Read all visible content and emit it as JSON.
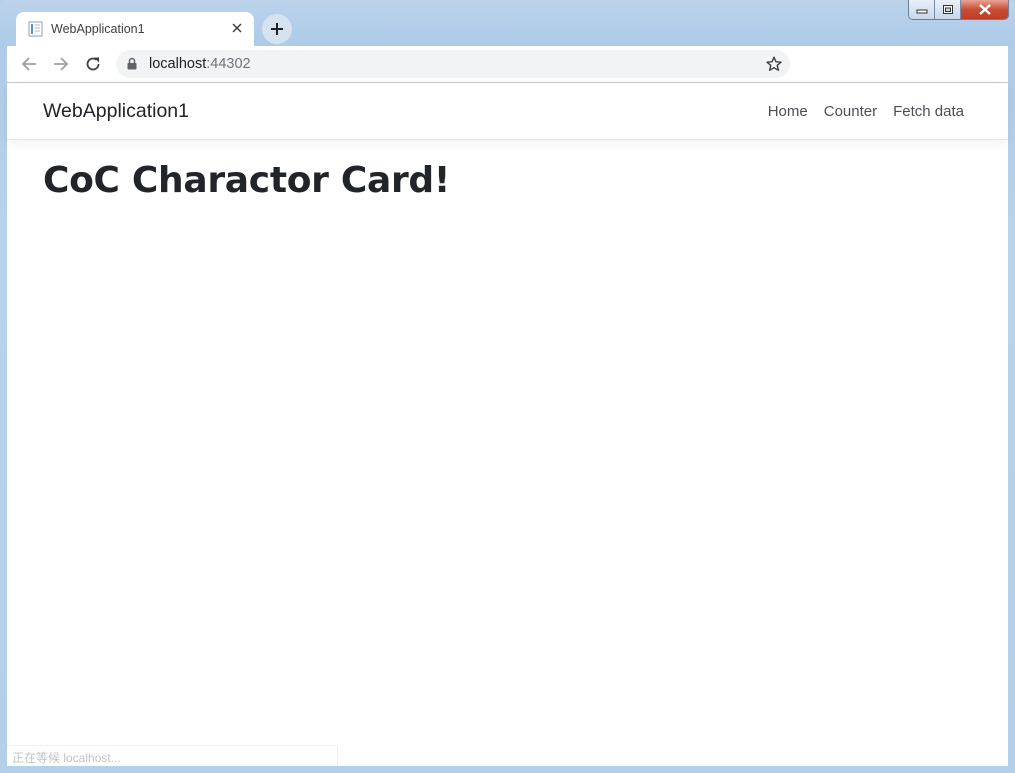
{
  "browser": {
    "tab": {
      "title": "WebApplication1"
    },
    "address": {
      "host": "localhost",
      "port": ":44302"
    },
    "status_text": "正在等候 localhost..."
  },
  "navbar": {
    "brand": "WebApplication1",
    "links": [
      {
        "label": "Home"
      },
      {
        "label": "Counter"
      },
      {
        "label": "Fetch data"
      }
    ]
  },
  "main": {
    "heading": "CoC Charactor Card!"
  },
  "colors": {
    "frame": "#b4cfe9",
    "close_button": "#c74e36",
    "text": "#212529"
  }
}
